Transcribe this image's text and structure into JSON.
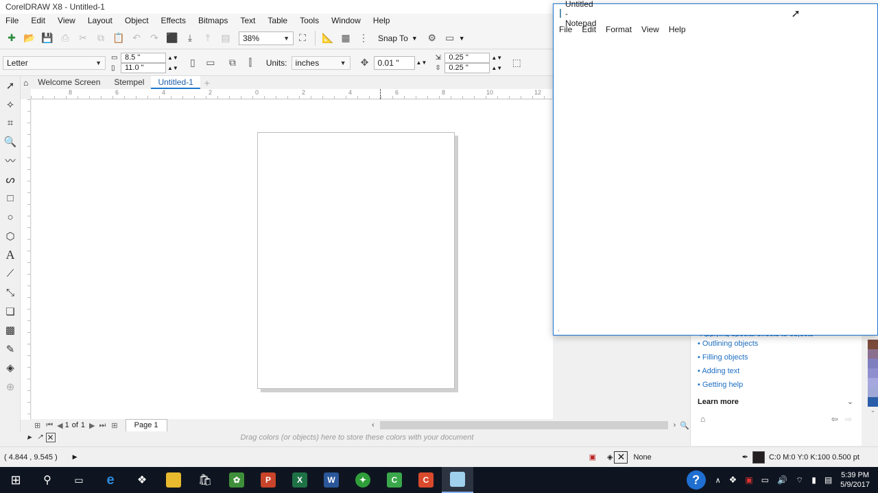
{
  "app": {
    "title": "CorelDRAW X8 - Untitled-1",
    "menu": [
      "File",
      "Edit",
      "View",
      "Layout",
      "Object",
      "Effects",
      "Bitmaps",
      "Text",
      "Table",
      "Tools",
      "Window",
      "Help"
    ]
  },
  "toolbar": {
    "zoom": "38%",
    "snap_to": "Snap To"
  },
  "propbar": {
    "page_size": "Letter",
    "width": "8.5 \"",
    "height": "11.0 \"",
    "units_label": "Units:",
    "units_value": "inches",
    "nudge": "0.01 \"",
    "dup_x": "0.25 \"",
    "dup_y": "0.25 \""
  },
  "tabs": [
    "Welcome Screen",
    "Stempel",
    "Untitled-1"
  ],
  "ruler_ticks": [
    "8",
    "6",
    "4",
    "2",
    "0",
    "2",
    "4",
    "6",
    "8",
    "10",
    "12"
  ],
  "page_nav": {
    "current": "1",
    "of": "of",
    "total": "1",
    "page_tab": "Page 1"
  },
  "color_strip_hint": "Drag colors (or objects) here to store these colors with your document",
  "docker": {
    "partial": "Applying special effects to objects",
    "links": [
      "Outlining objects",
      "Filling objects",
      "Adding text",
      "Getting help"
    ],
    "learn_more": "Learn more"
  },
  "status": {
    "coords": "( 4.844 , 9.545 )",
    "fill": "None",
    "outline": "C:0 M:0 Y:0 K:100  0.500 pt",
    "fill_color": "#ffffff",
    "outline_color": "#231f20"
  },
  "notepad": {
    "title": "Untitled - Notepad",
    "menu": [
      "File",
      "Edit",
      "Format",
      "View",
      "Help"
    ],
    "content": ""
  },
  "taskbar": {
    "time": "5:39 PM",
    "date": "5/9/2017",
    "apps": [
      "start-icon",
      "search-icon",
      "task-view-icon",
      "edge-icon",
      "dropbox-icon",
      "file-explorer-icon",
      "store-icon",
      "app-green-icon",
      "powerpoint-icon",
      "excel-icon",
      "word-icon",
      "app-logo-icon",
      "camtasia-recorder-icon",
      "camtasia-icon",
      "notepad-icon"
    ]
  },
  "palette_colors": [
    "#7a4a3a",
    "#8b6f8f",
    "#7f7fbf",
    "#8f8fd0",
    "#a7a7e0",
    "#9fa8d6",
    "#2a5ea8"
  ]
}
